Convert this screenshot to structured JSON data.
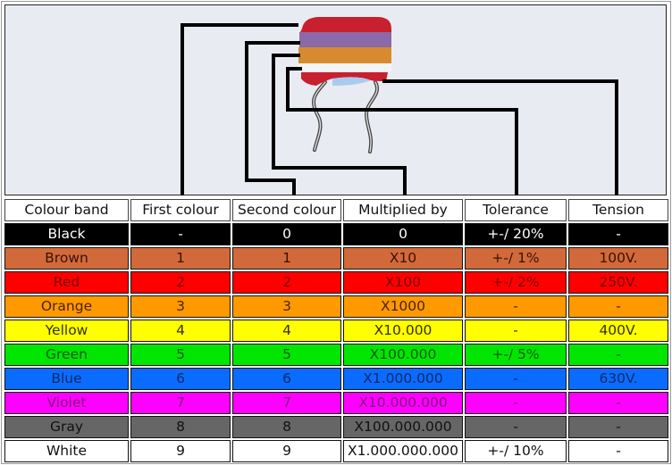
{
  "columns": [
    "Colour band",
    "First colour",
    "Second colour",
    "Multiplied by",
    "Tolerance",
    "Tension"
  ],
  "rows": [
    {
      "band": "Black",
      "first": "-",
      "second": "0",
      "multiplier": "0",
      "tolerance": "+-/ 20%",
      "tension": "-",
      "bg": "#000000",
      "fg": "#ffffff"
    },
    {
      "band": "Brown",
      "first": "1",
      "second": "1",
      "multiplier": "X10",
      "tolerance": "+-/ 1%",
      "tension": "100V.",
      "bg": "#d2693a",
      "fg": "#3a1206"
    },
    {
      "band": "Red",
      "first": "2",
      "second": "2",
      "multiplier": "X100",
      "tolerance": "+-/ 2%",
      "tension": "250V.",
      "bg": "#ff0000",
      "fg": "#7a0000"
    },
    {
      "band": "Orange",
      "first": "3",
      "second": "3",
      "multiplier": "X1000",
      "tolerance": "-",
      "tension": "-",
      "bg": "#ff9900",
      "fg": "#4a2200"
    },
    {
      "band": "Yellow",
      "first": "4",
      "second": "4",
      "multiplier": "X10.000",
      "tolerance": "-",
      "tension": "400V.",
      "bg": "#ffff00",
      "fg": "#333300"
    },
    {
      "band": "Green",
      "first": "5",
      "second": "5",
      "multiplier": "X100.000",
      "tolerance": "+-/ 5%",
      "tension": "-",
      "bg": "#00e600",
      "fg": "#0a5a0a"
    },
    {
      "band": "Blue",
      "first": "6",
      "second": "6",
      "multiplier": "X1.000.000",
      "tolerance": "-",
      "tension": "630V.",
      "bg": "#0a6cff",
      "fg": "#0a2a6a"
    },
    {
      "band": "Violet",
      "first": "7",
      "second": "7",
      "multiplier": "X10.000.000",
      "tolerance": "-",
      "tension": "-",
      "bg": "#ff00ff",
      "fg": "#7a1a7a"
    },
    {
      "band": "Gray",
      "first": "8",
      "second": "8",
      "multiplier": "X100.000.000",
      "tolerance": "-",
      "tension": "-",
      "bg": "#666666",
      "fg": "#111111"
    },
    {
      "band": "White",
      "first": "9",
      "second": "9",
      "multiplier": "X1.000.000.000",
      "tolerance": "+-/ 10%",
      "tension": "-",
      "bg": "#ffffff",
      "fg": "#111111"
    }
  ],
  "capacitor": {
    "band_colors": [
      "#c8202e",
      "#8a6aa8",
      "#d88a2e",
      "#c8202e"
    ],
    "leader_targets": [
      "First colour",
      "Second colour",
      "Multiplied by",
      "Tolerance",
      "Tension"
    ]
  }
}
